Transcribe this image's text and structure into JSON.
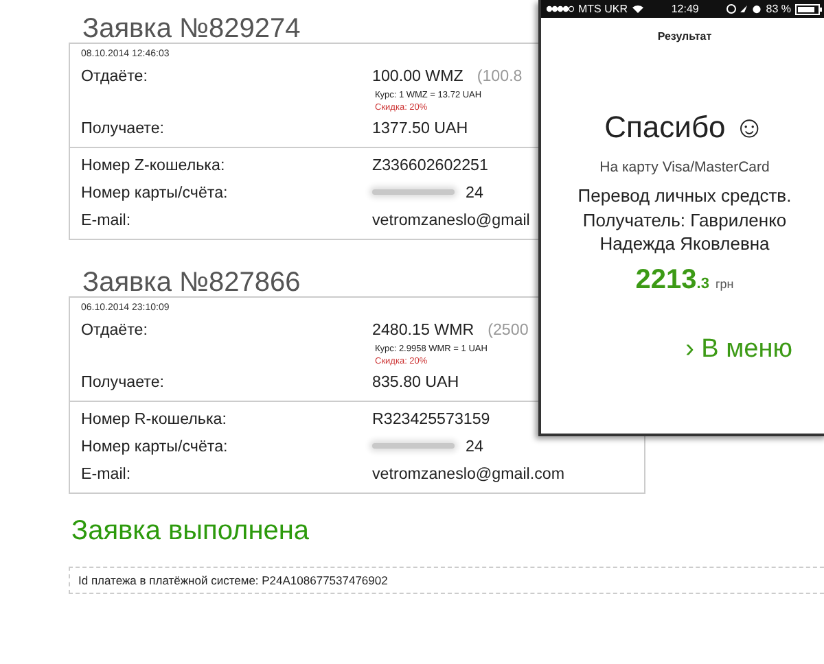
{
  "orders": [
    {
      "title": "Заявка №829274",
      "date": "08.10.2014 12:46:03",
      "give_label": "Отдаёте:",
      "give_value": "100.00 WMZ",
      "give_extra": "(100.8",
      "rate": "Курс: 1 WMZ = 13.72 UAH",
      "discount": "Скидка: 20%",
      "get_label": "Получаете:",
      "get_value": "1377.50 UAH",
      "fields": [
        {
          "label": "Номер Z-кошелька:",
          "value": "Z336602602251",
          "redacted": false
        },
        {
          "label": "Номер карты/счёта:",
          "value": "24",
          "redacted": true
        },
        {
          "label": "E-mail:",
          "value": "vetromzaneslo@gmail",
          "redacted": false
        }
      ]
    },
    {
      "title": "Заявка №827866",
      "date": "06.10.2014 23:10:09",
      "give_label": "Отдаёте:",
      "give_value": "2480.15 WMR",
      "give_extra": "(2500",
      "rate": "Курс: 2.9958 WMR = 1 UAH",
      "discount": "Скидка: 20%",
      "get_label": "Получаете:",
      "get_value": "835.80 UAH",
      "fields": [
        {
          "label": "Номер R-кошелька:",
          "value": "R323425573159",
          "redacted": false
        },
        {
          "label": "Номер карты/счёта:",
          "value": "24",
          "redacted": true
        },
        {
          "label": "E-mail:",
          "value": "vetromzaneslo@gmail.com",
          "redacted": false
        }
      ]
    }
  ],
  "done_title": "Заявка выполнена",
  "payment_id": "Id платежа в платёжной системе: P24A108677537476902",
  "phone": {
    "carrier": "MTS UKR",
    "time": "12:49",
    "battery": "83 %",
    "header": "Результат",
    "thanks": "Спасибо ☺",
    "subtitle": "На карту Visa/MasterCard",
    "details": [
      "Перевод личных средств.",
      "Получатель: Гавриленко",
      "Надежда Яковлевна"
    ],
    "amount": "2213",
    "amount_fraction": ".3",
    "currency": "грн",
    "menu_arrow": "›",
    "menu_link": "В меню"
  }
}
